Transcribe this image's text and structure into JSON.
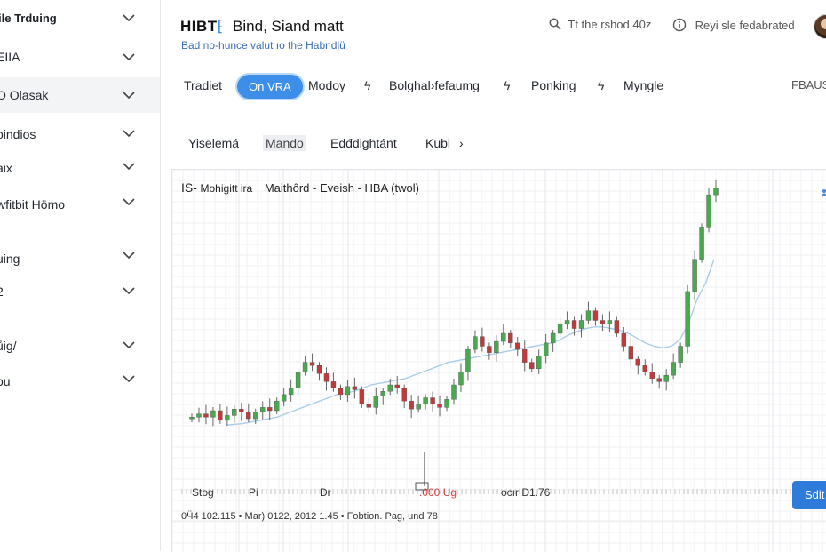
{
  "sidebar": {
    "title": "ile Trduing",
    "items": [
      {
        "label": "EIIA",
        "active": false
      },
      {
        "label": "O Olasak",
        "active": true
      },
      {
        "label": "pindios",
        "active": false
      },
      {
        "label": "aix",
        "active": false
      },
      {
        "label": "wfitbit Hömo",
        "active": false
      },
      {
        "label": "uing",
        "active": false
      },
      {
        "label": "2",
        "active": false
      },
      {
        "label": "ůig/",
        "active": false
      },
      {
        "label": "ou",
        "active": false
      }
    ]
  },
  "header": {
    "logo": "HIBT",
    "logo_mark": "⁅",
    "title": "Bind, Siand matt",
    "subtitle": "Bad no-hunce valut ıo the Habndlü",
    "search_label": "Tt the rshod 40z",
    "review_label": "Reyi sle fedabrated",
    "search_icon": "search-icon",
    "review_icon": "info-circle-icon"
  },
  "tabs": {
    "items": [
      "Tradiet",
      "On VRA",
      "Modoy",
      "Bolghal›fefaumg",
      "Ponking",
      "Myngle"
    ],
    "active_index": 1,
    "separator": "ϟ",
    "right_label": "FBAUS"
  },
  "subtabs": {
    "items": [
      "Yiselemá",
      "Mando",
      "Edđdightánt",
      "Kubi"
    ],
    "selected_index": 1,
    "more": "›"
  },
  "chart": {
    "title_prefix": "IS-",
    "title_a": "Mohigitt ira",
    "title_b": "Maithôrd - Eveish - HBA (twol)",
    "bottom": {
      "a": "Stog",
      "b": "Pi",
      "c": "Dr",
      "d": ".000 Ug",
      "e": "ocır Ð1.76"
    },
    "footer": "0Ӵ4 102.115 • Mar) 0122, 2012 1.45 • Fobtion. Pag, und 78",
    "edit_button": "Sdit"
  },
  "colors": {
    "accent": "#3d8ee8",
    "up": "#4aa84f",
    "down": "#c0393b",
    "ma": "#a9cde8"
  },
  "chart_data": {
    "type": "candlestick",
    "series": [
      {
        "name": "price",
        "values": [
          52,
          54,
          52,
          56,
          50,
          53,
          57,
          55,
          51,
          55,
          58,
          56,
          62,
          66,
          70,
          80,
          86,
          84,
          79,
          74,
          70,
          66,
          71,
          69,
          60,
          58,
          65,
          68,
          72,
          70,
          62,
          57,
          60,
          64,
          60,
          58,
          63,
          72,
          80,
          94,
          102,
          96,
          92,
          99,
          104,
          98,
          94,
          86,
          82,
          90,
          98,
          104,
          110,
          112,
          107,
          112,
          118,
          112,
          110,
          112,
          104,
          96,
          88,
          84,
          80,
          76,
          74,
          78,
          86,
          96,
          130,
          150,
          170,
          190,
          194
        ]
      },
      {
        "name": "moving average",
        "values": [
          47,
          47.5,
          48,
          49,
          50,
          51,
          52,
          54,
          56,
          58,
          60,
          62,
          64,
          66,
          67,
          68,
          70,
          72,
          73,
          74,
          75,
          76,
          78,
          80,
          82,
          84,
          86,
          87,
          88,
          89,
          90,
          91,
          92,
          93,
          94,
          95,
          96,
          97,
          98,
          100,
          103,
          105,
          107,
          108,
          108,
          107,
          106,
          104,
          101,
          98,
          96,
          95,
          96,
          100,
          110,
          125,
          135,
          150
        ]
      }
    ]
  }
}
